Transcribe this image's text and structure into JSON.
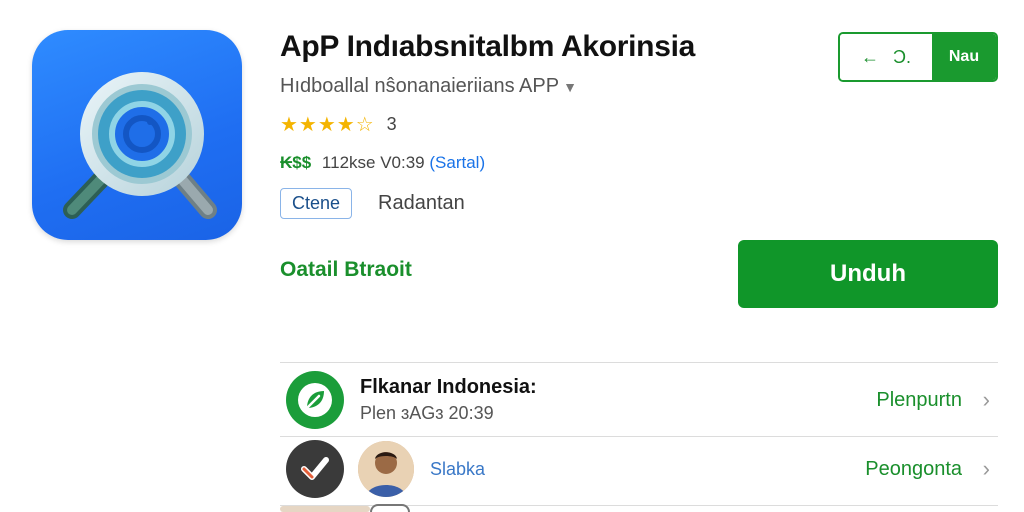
{
  "app": {
    "title": "ApP Indıabsnitalbm Akorinsia",
    "subtitle": "Hıdboallal nŝonanaieriians APP",
    "rating_stars": "★★★★☆",
    "rating_value": "3",
    "meta_price": "₭$$",
    "meta_size": "112kse V0:39",
    "meta_link": "(Sartal)",
    "tag_label": "Ctene",
    "tag_text": "Radantan",
    "detail_link": "Oatail Btraoit"
  },
  "header": {
    "share_arrow": "←",
    "share_letter": "Ɔ.",
    "share_right_label": "Nau"
  },
  "install": {
    "label": "Unduh"
  },
  "developer": {
    "name": "Flkanar Indonesia:",
    "sub": "Plen ɜAGɜ 20:39",
    "action": "Plenpurtn"
  },
  "review": {
    "label": "Slabka",
    "action": "Peongonta"
  },
  "colors": {
    "accent_green": "#109629",
    "icon_blue": "#1f6ef2",
    "star_yellow": "#f4b400"
  }
}
